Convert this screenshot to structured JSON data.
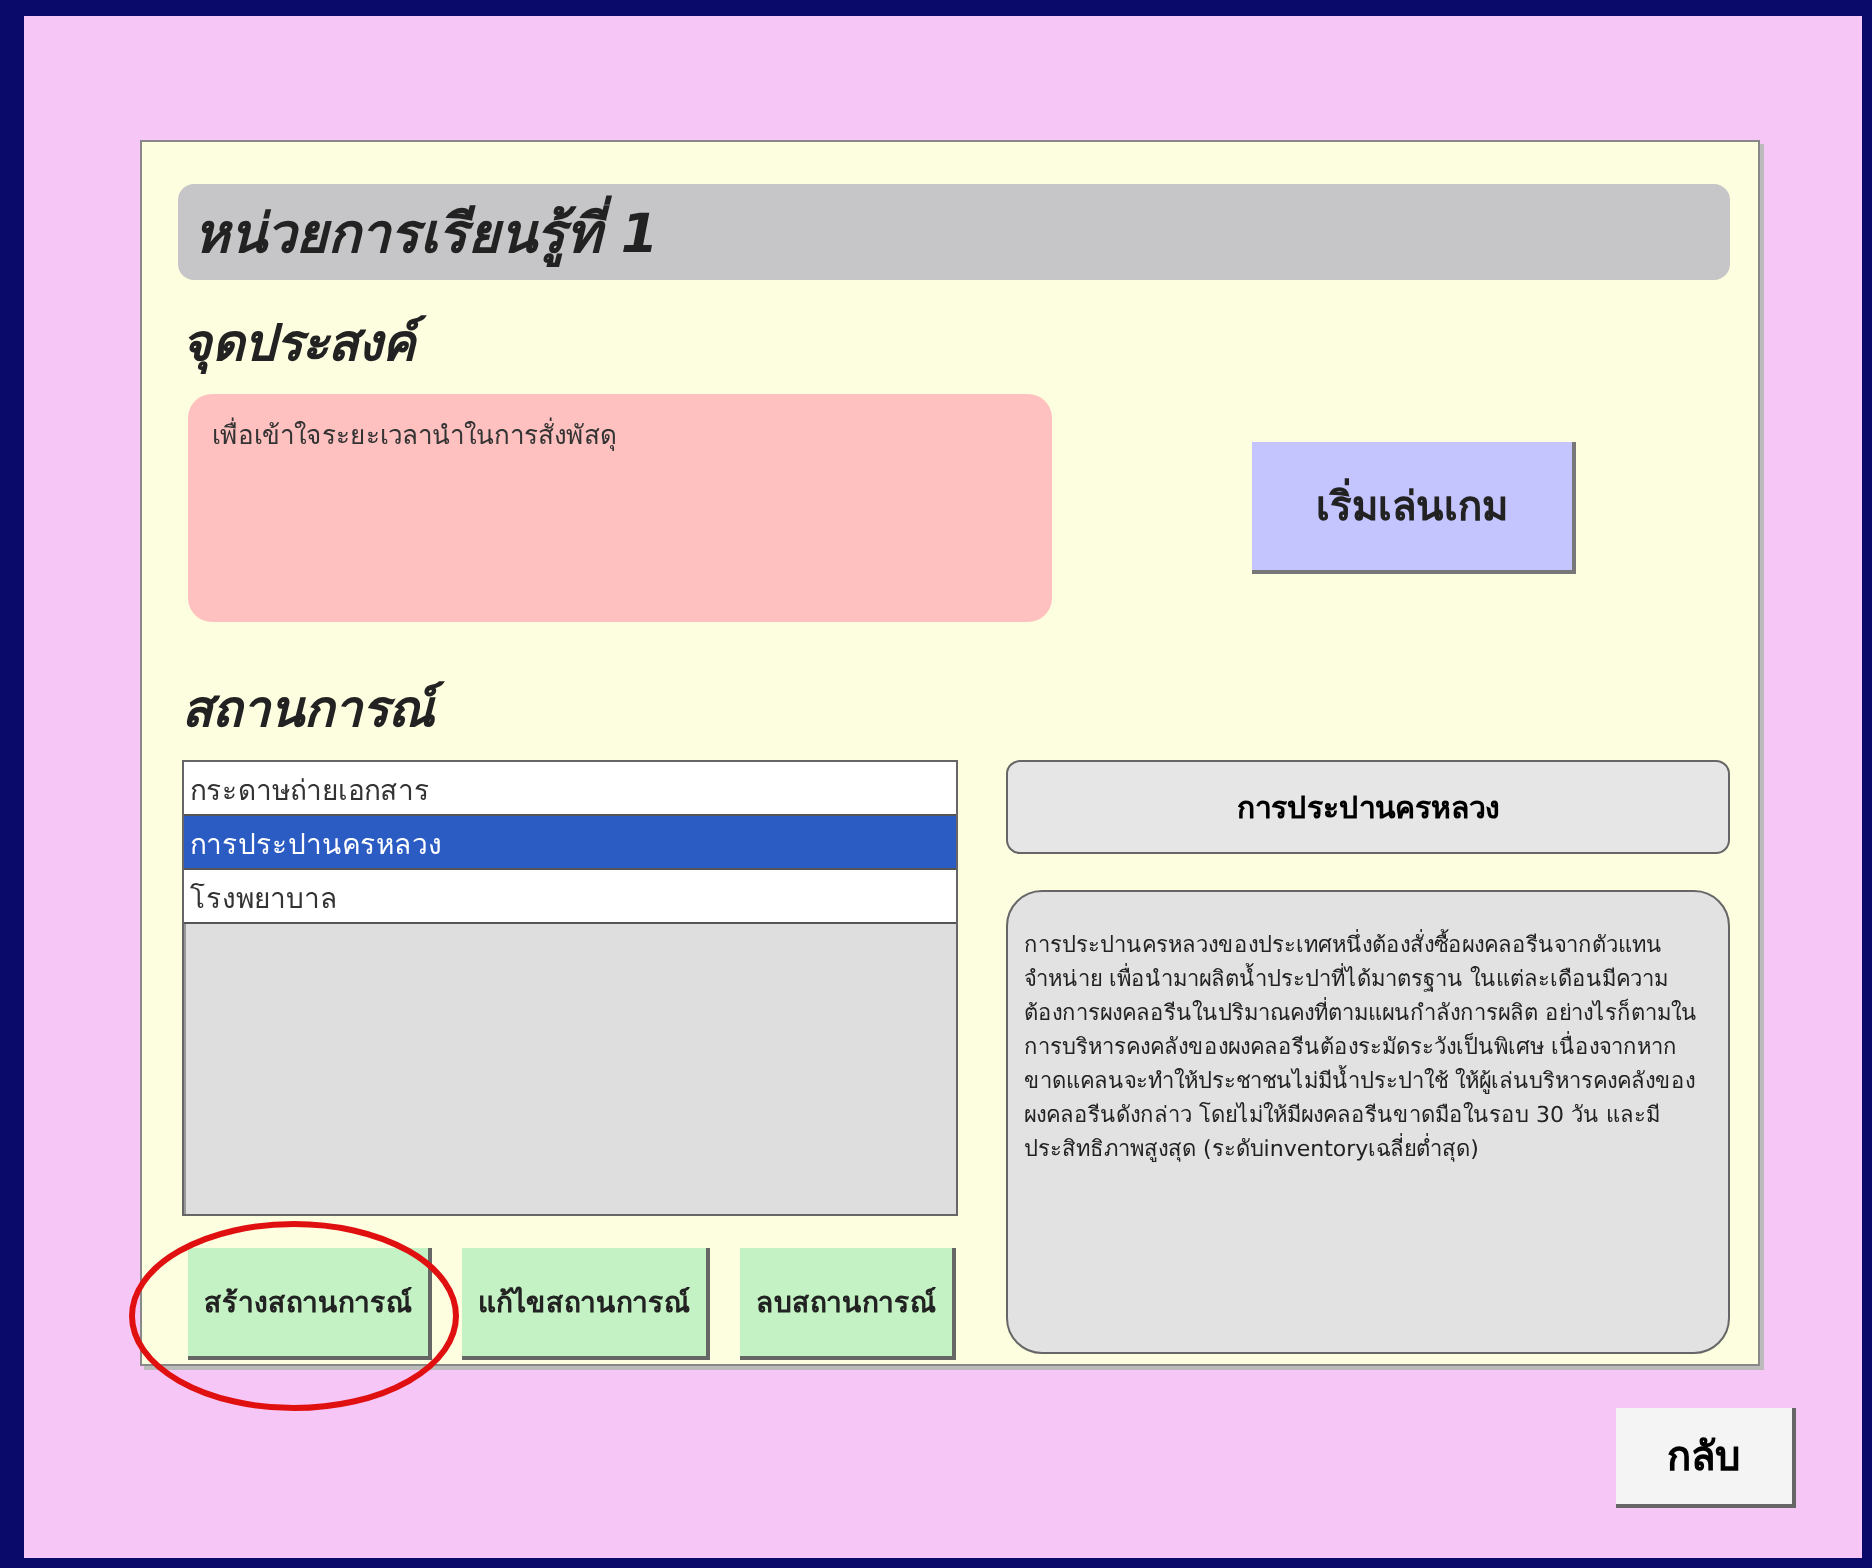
{
  "unit_title": "หน่วยการเรียนรู้ที่ 1",
  "objective": {
    "heading": "จุดประสงค์",
    "text": "เพื่อเข้าใจระยะเวลานำในการสั่งพัสดุ"
  },
  "start_button": "เริ่มเล่นเกม",
  "scenarios": {
    "heading": "สถานการณ์",
    "items": [
      {
        "label": "กระดาษถ่ายเอกสาร",
        "selected": false
      },
      {
        "label": "การประปานครหลวง",
        "selected": true
      },
      {
        "label": "โรงพยาบาล",
        "selected": false
      }
    ]
  },
  "scenario_title": "การประปานครหลวง",
  "scenario_description": "การประปานครหลวงของประเทศหนึ่งต้องสั่งซื้อผงคลอรีนจากตัวแทนจำหน่าย เพื่อนำมาผลิตน้ำประปาที่ได้มาตรฐาน ในแต่ละเดือนมีความต้องการผงคลอรีนในปริมาณคงที่ตามแผนกำลังการผลิต อย่างไรก็ตามในการบริหารคงคลังของผงคลอรีนต้องระมัดระวังเป็นพิเศษ เนื่องจากหากขาดแคลนจะทำให้ประชาชนไม่มีน้ำประปาใช้ ให้ผู้เล่นบริหารคงคลังของผงคลอรีนดังกล่าว โดยไม่ให้มีผงคลอรีนขาดมือในรอบ 30 วัน และมีประสิทธิภาพสูงสุด (ระดับinventoryเฉลี่ยต่ำสุด)",
  "scenario_buttons": [
    {
      "label": "สร้างสถานการณ์",
      "highlighted": true
    },
    {
      "label": "แก้ไขสถานการณ์",
      "highlighted": false
    },
    {
      "label": "ลบสถานการณ์",
      "highlighted": false
    }
  ],
  "back_button": "กลับ"
}
